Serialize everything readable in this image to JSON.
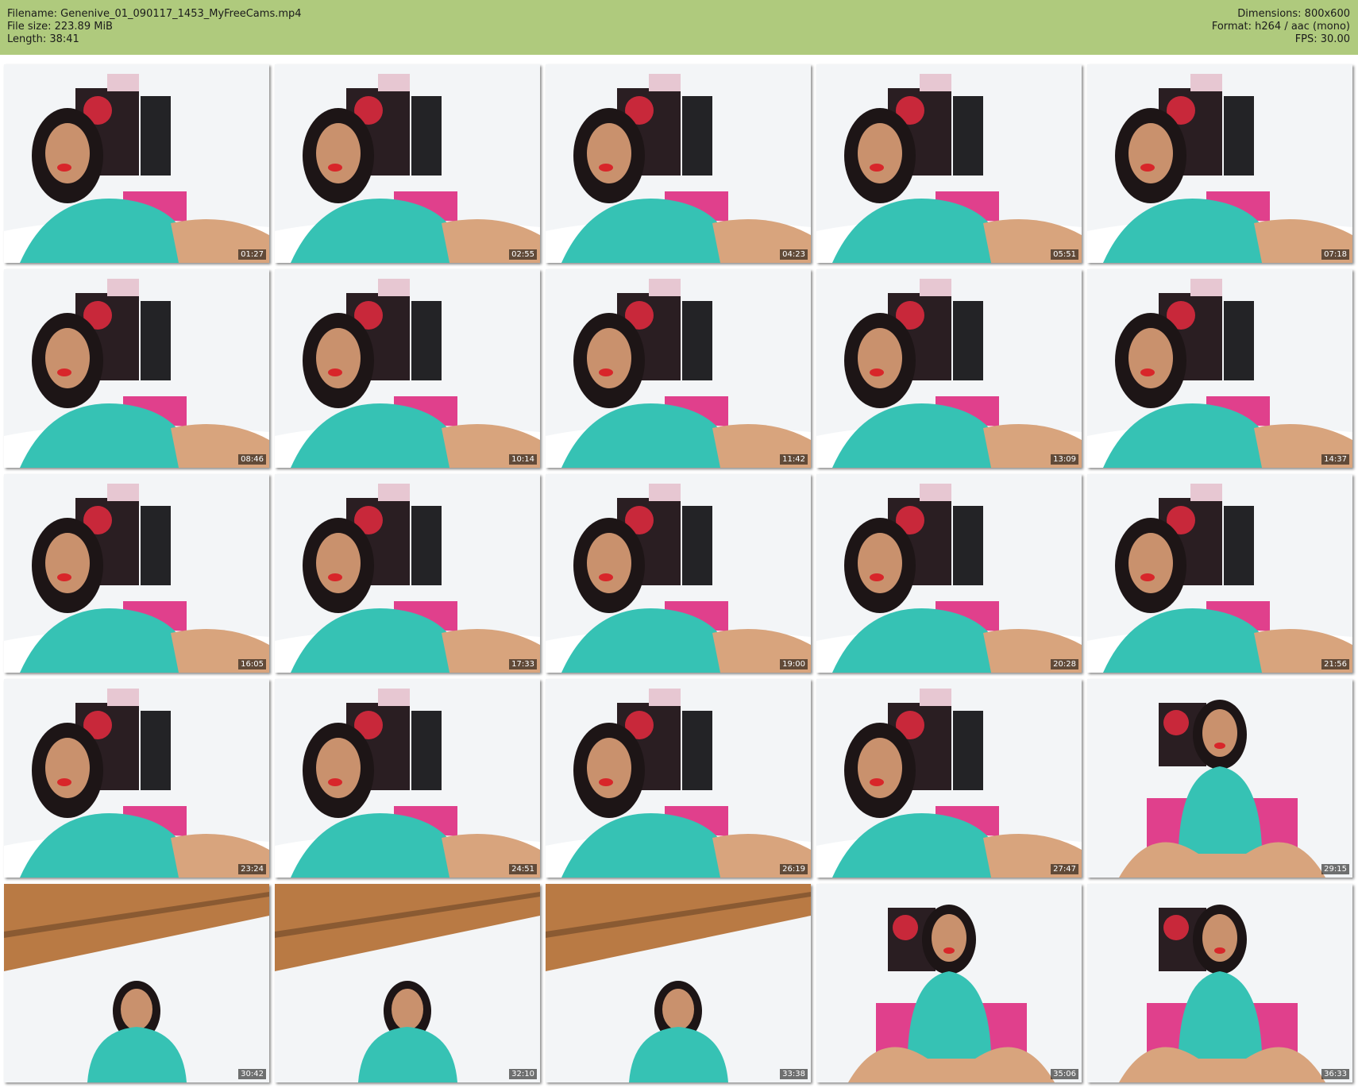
{
  "header": {
    "filename": "Filename: Genenive_01_090117_1453_MyFreeCams.mp4",
    "filesize": "File size: 223.89 MiB",
    "length": "Length: 38:41",
    "dimensions": "Dimensions: 800x600",
    "format": "Format: h264 / aac (mono)",
    "fps": "FPS: 30.00"
  },
  "colors": {
    "header_bg": "#afca7d",
    "hoodie": "#36c2b4",
    "wall": "#f3f5f7",
    "headboard": "#e0408c",
    "ceiling_wood": "#b97a44"
  },
  "thumbnails": [
    {
      "timestamp": "01:27",
      "scene": "bed"
    },
    {
      "timestamp": "02:55",
      "scene": "bed"
    },
    {
      "timestamp": "04:23",
      "scene": "bed"
    },
    {
      "timestamp": "05:51",
      "scene": "bed"
    },
    {
      "timestamp": "07:18",
      "scene": "bed"
    },
    {
      "timestamp": "08:46",
      "scene": "bed"
    },
    {
      "timestamp": "10:14",
      "scene": "bed"
    },
    {
      "timestamp": "11:42",
      "scene": "bed"
    },
    {
      "timestamp": "13:09",
      "scene": "bed"
    },
    {
      "timestamp": "14:37",
      "scene": "bed"
    },
    {
      "timestamp": "16:05",
      "scene": "bed"
    },
    {
      "timestamp": "17:33",
      "scene": "bed"
    },
    {
      "timestamp": "19:00",
      "scene": "bed"
    },
    {
      "timestamp": "20:28",
      "scene": "bed"
    },
    {
      "timestamp": "21:56",
      "scene": "bed"
    },
    {
      "timestamp": "23:24",
      "scene": "bed"
    },
    {
      "timestamp": "24:51",
      "scene": "bed"
    },
    {
      "timestamp": "26:19",
      "scene": "bed"
    },
    {
      "timestamp": "27:47",
      "scene": "bed"
    },
    {
      "timestamp": "29:15",
      "scene": "sitting"
    },
    {
      "timestamp": "30:42",
      "scene": "ceiling"
    },
    {
      "timestamp": "32:10",
      "scene": "ceiling"
    },
    {
      "timestamp": "33:38",
      "scene": "ceiling"
    },
    {
      "timestamp": "35:06",
      "scene": "sitting"
    },
    {
      "timestamp": "36:33",
      "scene": "sitting"
    }
  ]
}
